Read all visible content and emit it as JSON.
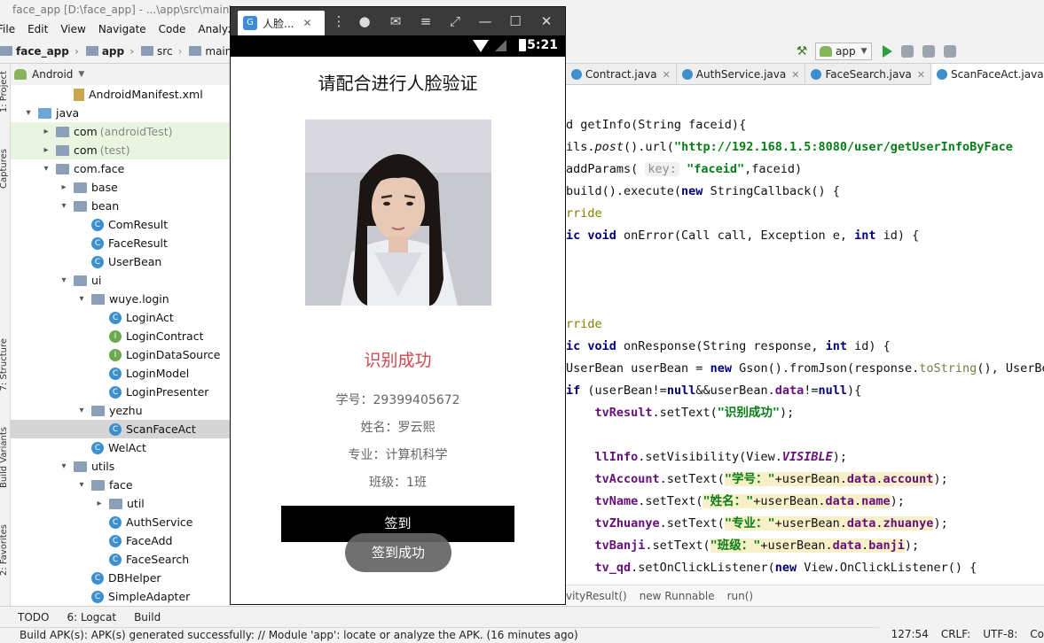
{
  "ide": {
    "title": "face_app [D:\\face_app] - ...\\app\\src\\main\\",
    "menu": [
      "File",
      "Edit",
      "View",
      "Navigate",
      "Code",
      "Analyze"
    ],
    "breadcrumbs": [
      "face_app",
      "app",
      "src",
      "main"
    ],
    "run_config": "app",
    "project_view": "Android",
    "left_tabs": [
      "1: Project",
      "Captures",
      "7: Structure",
      "Build Variants",
      "2: Favorites"
    ],
    "tree": [
      {
        "label": "AndroidManifest.xml",
        "indent": 4,
        "icon": "manifest"
      },
      {
        "label": "java",
        "indent": 2,
        "icon": "folder-blue",
        "arrow": "▾"
      },
      {
        "label": "com",
        "suffix": "(androidTest)",
        "indent": 3,
        "icon": "folder",
        "arrow": "▸",
        "bg": "green"
      },
      {
        "label": "com",
        "suffix": "(test)",
        "indent": 3,
        "icon": "folder",
        "arrow": "▸",
        "bg": "green"
      },
      {
        "label": "com.face",
        "indent": 3,
        "icon": "folder",
        "arrow": "▾"
      },
      {
        "label": "base",
        "indent": 4,
        "icon": "folder",
        "arrow": "▸"
      },
      {
        "label": "bean",
        "indent": 4,
        "icon": "folder",
        "arrow": "▾"
      },
      {
        "label": "ComResult",
        "indent": 5,
        "icon": "class"
      },
      {
        "label": "FaceResult",
        "indent": 5,
        "icon": "class"
      },
      {
        "label": "UserBean",
        "indent": 5,
        "icon": "class"
      },
      {
        "label": "ui",
        "indent": 4,
        "icon": "folder",
        "arrow": "▾"
      },
      {
        "label": "wuye.login",
        "indent": 5,
        "icon": "folder",
        "arrow": "▾"
      },
      {
        "label": "LoginAct",
        "indent": 6,
        "icon": "class"
      },
      {
        "label": "LoginContract",
        "indent": 6,
        "icon": "iface"
      },
      {
        "label": "LoginDataSource",
        "indent": 6,
        "icon": "iface"
      },
      {
        "label": "LoginModel",
        "indent": 6,
        "icon": "class"
      },
      {
        "label": "LoginPresenter",
        "indent": 6,
        "icon": "class"
      },
      {
        "label": "yezhu",
        "indent": 5,
        "icon": "folder",
        "arrow": "▾"
      },
      {
        "label": "ScanFaceAct",
        "indent": 6,
        "icon": "class",
        "bg": "sel"
      },
      {
        "label": "WelAct",
        "indent": 5,
        "icon": "class"
      },
      {
        "label": "utils",
        "indent": 4,
        "icon": "folder",
        "arrow": "▾"
      },
      {
        "label": "face",
        "indent": 5,
        "icon": "folder",
        "arrow": "▾"
      },
      {
        "label": "util",
        "indent": 6,
        "icon": "folder",
        "arrow": "▸"
      },
      {
        "label": "AuthService",
        "indent": 6,
        "icon": "class"
      },
      {
        "label": "FaceAdd",
        "indent": 6,
        "icon": "class"
      },
      {
        "label": "FaceSearch",
        "indent": 6,
        "icon": "class"
      },
      {
        "label": "DBHelper",
        "indent": 5,
        "icon": "class"
      },
      {
        "label": "SimpleAdapter",
        "indent": 5,
        "icon": "class"
      }
    ],
    "editor_tabs": [
      "Contract.java",
      "AuthService.java",
      "FaceSearch.java",
      "ScanFaceAct.java"
    ],
    "code_crumbs": [
      "vityResult()",
      "new Runnable",
      "run()"
    ],
    "bottom_tools": [
      "TODO",
      "6: Logcat",
      "Build"
    ],
    "status_message": "Build APK(s): APK(s) generated successfully: // Module 'app': locate or analyze the APK. (16 minutes ago)",
    "status_position": "127:54",
    "status_line_sep": "CRLF:",
    "status_encoding": "UTF-8:",
    "status_extra": "Co"
  },
  "emulator": {
    "tab_title": "人脸...",
    "status_time": "5:21",
    "screen": {
      "title": "请配合进行人脸验证",
      "result": "识别成功",
      "student_id": "学号：29399405672",
      "name": "姓名：罗云熙",
      "major": "专业：计算机科学",
      "class": "班级：1班",
      "button": "签到",
      "toast": "签到成功"
    }
  }
}
